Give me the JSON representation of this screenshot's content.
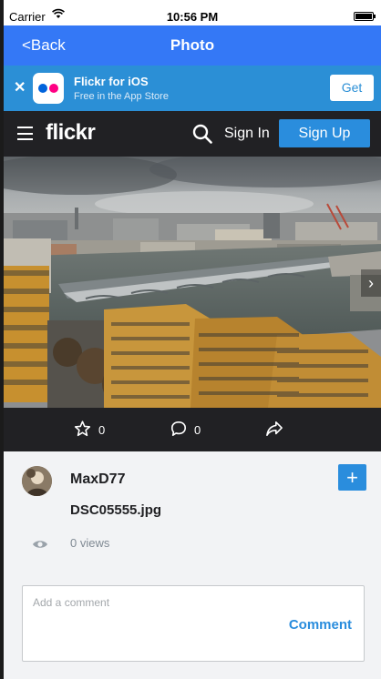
{
  "status_bar": {
    "carrier": "Carrier",
    "time": "10:56 PM"
  },
  "nav": {
    "back_label": "<Back",
    "title": "Photo"
  },
  "app_banner": {
    "close": "✕",
    "app_name": "Flickr for iOS",
    "subtitle": "Free in the App Store",
    "get_label": "Get"
  },
  "header": {
    "logo": "flickr",
    "sign_in": "Sign In",
    "sign_up": "Sign Up"
  },
  "photo": {
    "next_arrow": "›"
  },
  "actions": {
    "fave_count": "0",
    "comment_count": "0"
  },
  "details": {
    "username": "MaxD77",
    "add_label": "+",
    "filename": "DSC05555.jpg",
    "views": "0 views"
  },
  "comment": {
    "placeholder": "Add a comment",
    "submit_label": "Comment"
  },
  "colors": {
    "nav_blue": "#3478f6",
    "banner_blue": "#2b8fd6",
    "flickr_dark": "#212124",
    "accent": "#2a8ddd"
  }
}
